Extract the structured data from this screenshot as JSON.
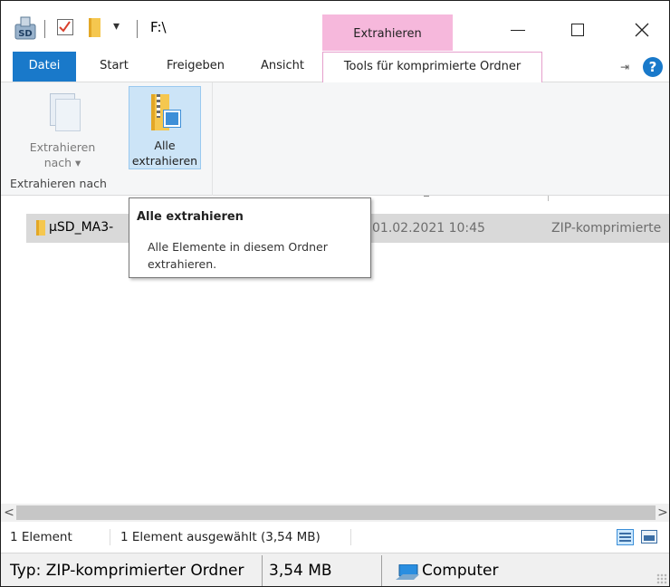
{
  "titlebar": {
    "path": "F:\\",
    "context_tab_header": "Extrahieren",
    "qat_dropdown": "▾",
    "minimize": "—",
    "maximize": "☐",
    "close": "✕"
  },
  "ribbon": {
    "tabs": [
      "Datei",
      "Start",
      "Freigeben",
      "Ansicht",
      "Tools für komprimierte Ordner"
    ],
    "active_tab": "Tools für komprimierte Ordner",
    "pin": "⇥",
    "help": "?",
    "extract_to_line1": "Extrahieren",
    "extract_to_line2": "nach ▾",
    "extract_all_line1": "Alle",
    "extract_all_line2": "extrahieren",
    "group_label": "Extrahieren nach"
  },
  "file_list": {
    "rows": [
      {
        "name": "µSD_MA3-",
        "date": "01.02.2021 10:45",
        "type": "ZIP-komprimierte"
      }
    ]
  },
  "tooltip": {
    "title": "Alle extrahieren",
    "body": "Alle Elemente in diesem Ordner extrahieren."
  },
  "scrollbar": {
    "left": "<",
    "right": ">"
  },
  "statusbar": {
    "count": "1 Element",
    "selected": "1 Element ausgewählt (3,54 MB)"
  },
  "legacy_status": {
    "type": "Typ: ZIP-komprimierter Ordner",
    "size": "3,54 MB",
    "location": "Computer"
  },
  "colors": {
    "accent": "#1979ca",
    "context_tab": "#f6b8dc",
    "selection": "#d9d9d9",
    "folder": "#f5c74f"
  }
}
